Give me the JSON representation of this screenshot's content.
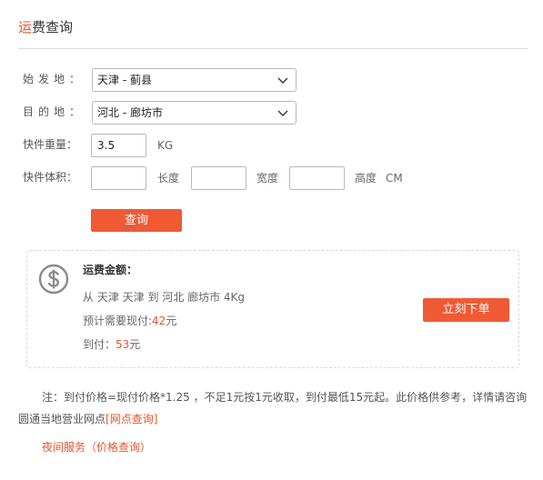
{
  "header": {
    "title_accent": "运",
    "title_rest": "费查询"
  },
  "form": {
    "origin_label": "始发地：",
    "origin_value": "天津 - 蓟县",
    "dest_label": "目的地：",
    "dest_value": "河北 - 廊坊市",
    "weight_label": "快件重量：",
    "weight_value": "3.5",
    "weight_unit": "KG",
    "volume_label": "快件体积：",
    "length_value": "",
    "length_unit": "长度",
    "width_value": "",
    "width_unit": "宽度",
    "height_value": "",
    "height_unit": "高度",
    "volume_unit": "CM",
    "query_button": "查询"
  },
  "result": {
    "title": "运费金额：",
    "route": "从 天津 天津 到 河北 廊坊市 4Kg",
    "prepay_label": "预计需要现付:",
    "prepay_amount": "42",
    "prepay_suffix": "元",
    "collect_label": "到付：",
    "collect_amount": "53",
    "collect_suffix": "元",
    "order_button": "立刻下单"
  },
  "note": {
    "text": "注：到付价格=现付价格*1.25 ，不足1元按1元收取，到付最低15元起。此价格供参考，详情请咨询圆通当地营业网点",
    "link": "[网点查询]"
  },
  "night_link": "夜间服务（价格查询）",
  "icons": {
    "select_arrow": "chevron-down-icon",
    "amount": "dollar-circle-icon"
  },
  "colors": {
    "accent": "#e8542b",
    "button": "#ef5a35",
    "border": "#b9b9b9"
  }
}
